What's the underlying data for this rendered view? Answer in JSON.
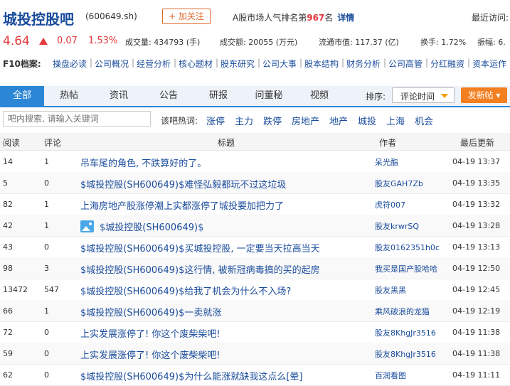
{
  "header": {
    "title": "城投控股吧",
    "code": "(600649.sh)",
    "follow_label": "+ 加关注",
    "rank_prefix": "A股市场人气排名第",
    "rank_num": "967",
    "rank_suffix": "名",
    "rank_detail": "详情",
    "visit_label": "最近访问:"
  },
  "quote": {
    "price": "4.64",
    "change": "0.07",
    "change_pct": "1.53%",
    "volume": "成交量: 434793 (手)",
    "amount": "成交额: 20055 (万元)",
    "float_cap": "流通市值: 117.37 (亿)",
    "turnover": "换手: 1.72%",
    "amplitude": "振幅: 6."
  },
  "f10": {
    "label": "F10档案:",
    "items": [
      "操盘必读",
      "公司概况",
      "经营分析",
      "核心题材",
      "股东研究",
      "公司大事",
      "股本结构",
      "财务分析",
      "公司高管",
      "分红融资",
      "资本运作"
    ]
  },
  "tabs": [
    "全部",
    "热帖",
    "资讯",
    "公告",
    "研报",
    "问董秘",
    "视频"
  ],
  "sort": {
    "label": "排序:",
    "value": "评论时间"
  },
  "post_label": "发新帖",
  "search": {
    "placeholder": "吧内搜索, 请输入关键词"
  },
  "hot": {
    "label": "该吧热词:",
    "words": [
      "涨停",
      "主力",
      "跌停",
      "房地产",
      "地产",
      "城投",
      "上海",
      "机会"
    ]
  },
  "table": {
    "headers": [
      "阅读",
      "评论",
      "标题",
      "作者",
      "最后更新"
    ],
    "rows": [
      {
        "read": "14",
        "comments": "1",
        "title": "吊车尾的角色, 不跌算好的了。",
        "author": "呆光酯",
        "updated": "04-19 13:37"
      },
      {
        "read": "5",
        "comments": "0",
        "title": "$城投控股(SH600649)$难怪弘毅都玩不过这垃圾",
        "author": "股友GAH7Zb",
        "updated": "04-19 13:35"
      },
      {
        "read": "82",
        "comments": "1",
        "title": "上海房地产股涨停潮上实都涨停了城投要加把力了",
        "author": "虎符007",
        "updated": "04-19 13:32"
      },
      {
        "read": "42",
        "comments": "1",
        "title": "$城投控股(SH600649)$",
        "author": "股友krwrSQ",
        "updated": "04-19 13:28",
        "has_image": true
      },
      {
        "read": "43",
        "comments": "0",
        "title": "$城投控股(SH600649)$买城投控股, 一定要当天拉高当天",
        "author": "股友0162351h0c",
        "updated": "04-19 13:13"
      },
      {
        "read": "98",
        "comments": "3",
        "title": "$城投控股(SH600649)$这行情, 被新冠病毒搞的买的起房",
        "author": "我买是国产股哈哈",
        "updated": "04-19 12:50"
      },
      {
        "read": "13472",
        "comments": "547",
        "title": "$城投控股(SH600649)$给我了机会为什么不入场?",
        "author": "股友黑黑",
        "updated": "04-19 12:45"
      },
      {
        "read": "66",
        "comments": "1",
        "title": "$城投控股(SH600649)$一卖就涨",
        "author": "乘风破浪的龙猫",
        "updated": "04-19 12:19"
      },
      {
        "read": "72",
        "comments": "0",
        "title": "上实发展涨停了! 你这个废柴柴吧!",
        "author": "股友8KhgJr3516",
        "updated": "04-19 11:38"
      },
      {
        "read": "59",
        "comments": "0",
        "title": "上实发展涨停了! 你这个废柴柴吧!",
        "author": "股友8KhgJr3516",
        "updated": "04-19 11:38"
      },
      {
        "read": "62",
        "comments": "0",
        "title": "$城投控股(SH600649)$为什么能涨就缺我这点么[晕]",
        "author": "百润看图",
        "updated": "04-19 11:11"
      }
    ]
  },
  "colors": {
    "brand_blue": "#1a4c9c",
    "tab_blue": "#2b86d6",
    "up_red": "#e4393c",
    "post_orange": "#f37f20"
  },
  "icons": {
    "image": "image-icon",
    "up": "up-arrow-icon",
    "dropdown": "chevron-down-icon"
  }
}
